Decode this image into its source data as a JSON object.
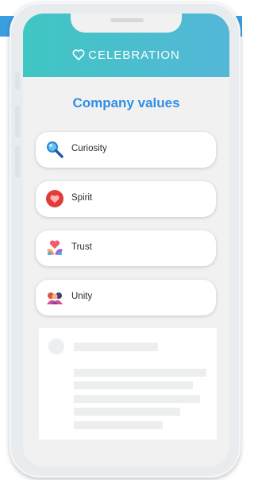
{
  "app": {
    "brand_name": "CELEBRATION",
    "brand_icon": "heart-outline-icon",
    "accent_color": "#2e8ee6",
    "header_gradient": [
      "#40c6c3",
      "#54b7d8"
    ]
  },
  "page": {
    "title": "Company values"
  },
  "values": [
    {
      "label": "Curiosity",
      "icon": "magnifier-icon"
    },
    {
      "label": "Spirit",
      "icon": "heart-icon"
    },
    {
      "label": "Trust",
      "icon": "hands-heart-icon"
    },
    {
      "label": "Unity",
      "icon": "people-icon"
    }
  ]
}
